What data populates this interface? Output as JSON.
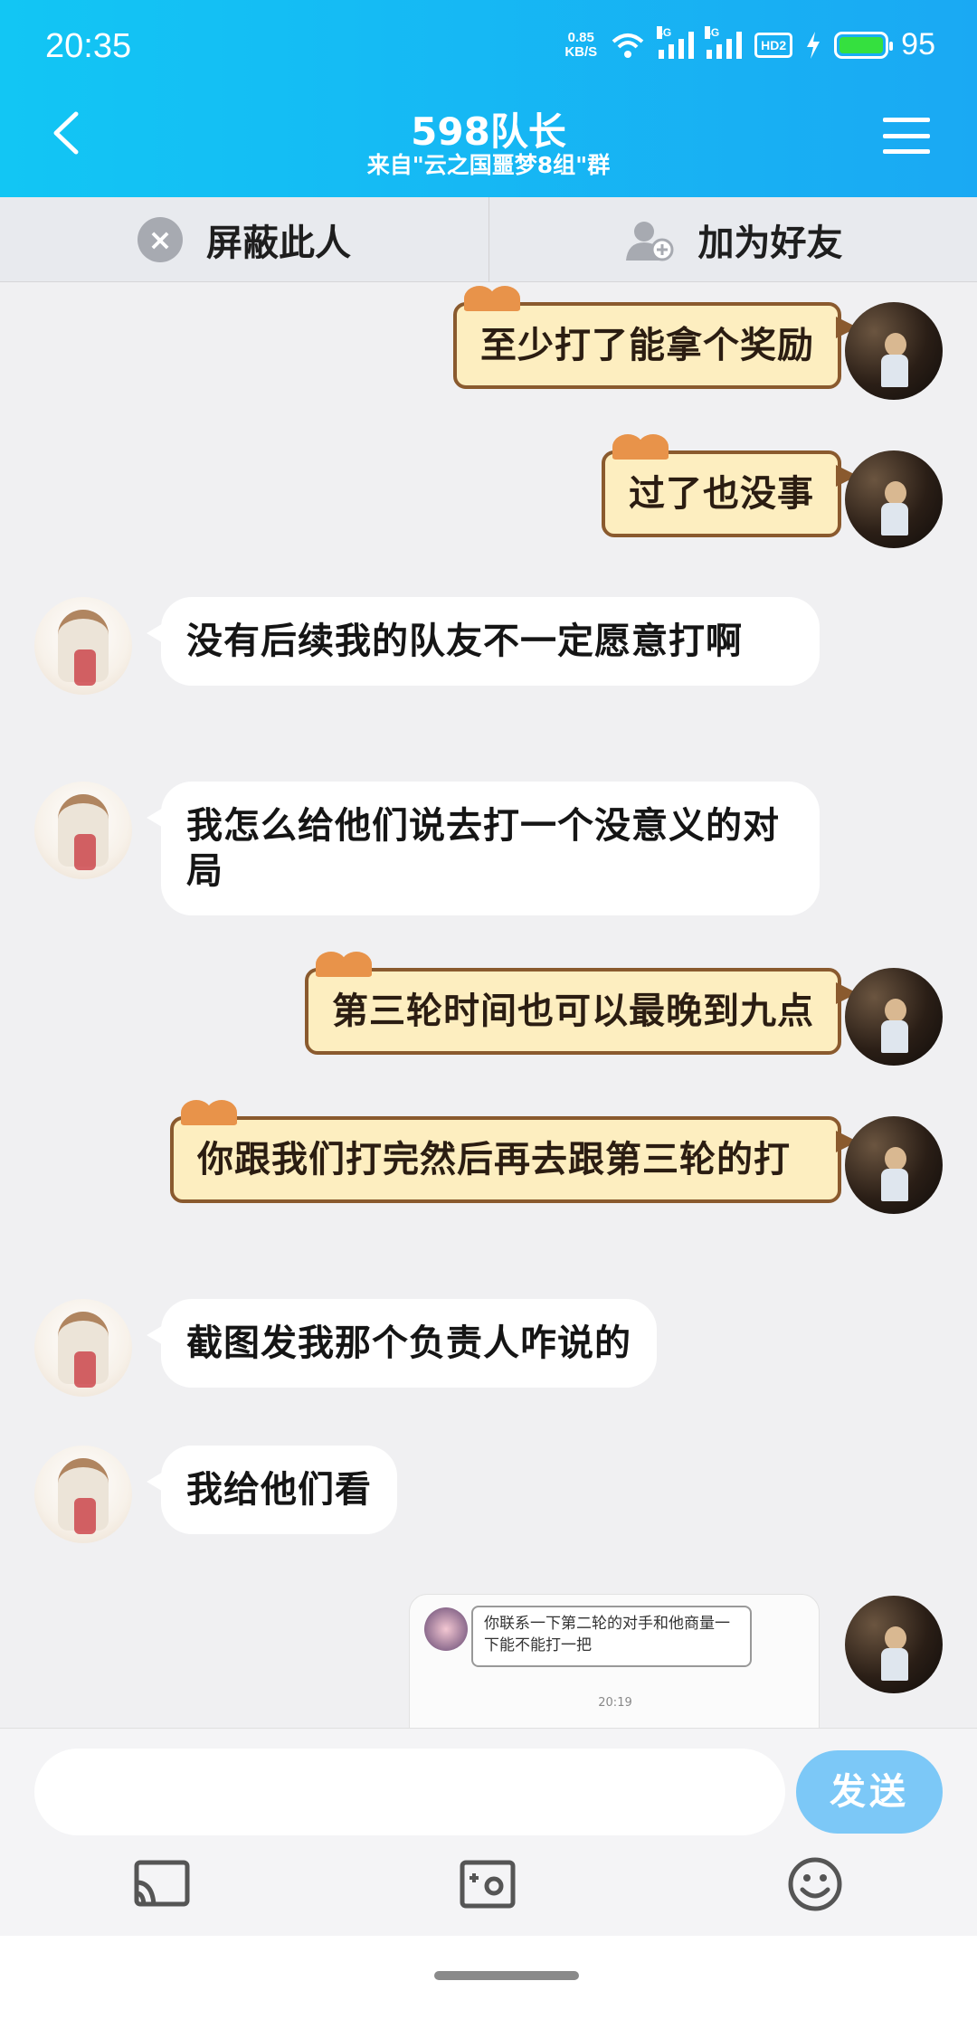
{
  "status": {
    "time": "20:35",
    "net_speed_top": "0.85",
    "net_speed_bottom": "KB/S",
    "sim1_tag": "4G",
    "sim2_tag": "4G",
    "hd_label": "HD2",
    "battery": "95"
  },
  "header": {
    "title": "598队长",
    "subtitle": "来自\"云之国噩梦8组\"群"
  },
  "actions": {
    "block_label": "屏蔽此人",
    "add_friend_label": "加为好友"
  },
  "messages": [
    {
      "sender": "me",
      "text": "至少打了能拿个奖励"
    },
    {
      "sender": "me",
      "text": "过了也没事"
    },
    {
      "sender": "other",
      "text": "没有后续我的队友不一定愿意打啊"
    },
    {
      "sender": "other",
      "text": "我怎么给他们说去打一个没意义的对局"
    },
    {
      "sender": "me",
      "text": "第三轮时间也可以最晚到九点"
    },
    {
      "sender": "me",
      "text": "你跟我们打完然后再去跟第三轮的打"
    },
    {
      "sender": "other",
      "text": "截图发我那个负责人咋说的"
    },
    {
      "sender": "other",
      "text": "我给他们看"
    }
  ],
  "image_message": {
    "text": "你联系一下第二轮的对手和他商量一下能不能打一把",
    "time": "20:19"
  },
  "input": {
    "placeholder": "",
    "value": "",
    "send_label": "发送"
  },
  "colors": {
    "header_start": "#12c6f4",
    "header_end": "#1aa9f3",
    "my_bubble": "#fdeec0",
    "send_button": "#7cc8f7"
  },
  "icons": [
    "back-arrow-icon",
    "menu-icon",
    "block-icon",
    "add-friend-icon",
    "cast-icon",
    "camera-icon",
    "emoji-icon"
  ]
}
